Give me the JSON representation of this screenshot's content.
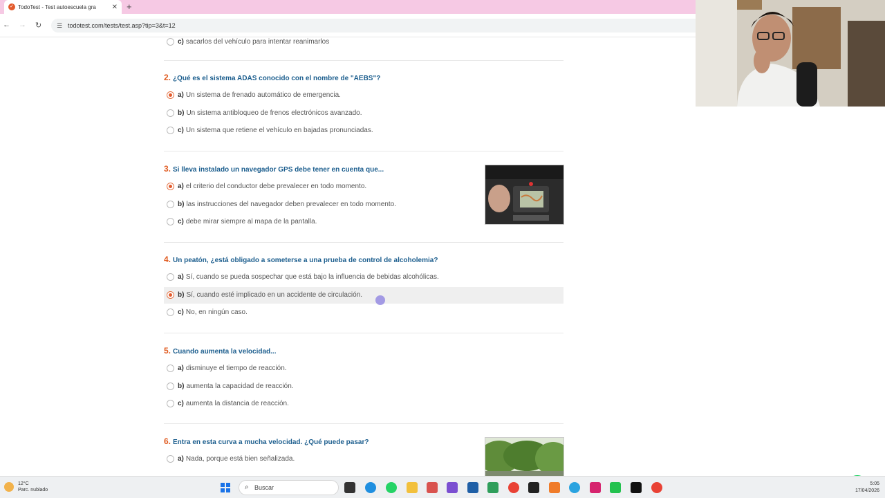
{
  "browser": {
    "tab_title": "TodoTest - Test autoescuela gra",
    "tab_favicon": "todotest-favicon",
    "new_tab_symbol": "+",
    "url": "todotest.com/tests/test.asp?tip=3&t=12"
  },
  "quiz": {
    "prev_option": {
      "letter": "c)",
      "text": "sacarlos del vehículo para intentar reanimarlos",
      "selected": false
    },
    "questions": [
      {
        "number": "2.",
        "title": "¿Qué es el sistema ADAS conocido con el nombre de \"AEBS\"?",
        "options": [
          {
            "letter": "a)",
            "text": "Un sistema de frenado automático de emergencia.",
            "selected": true
          },
          {
            "letter": "b)",
            "text": "Un sistema antibloqueo de frenos electrónicos avanzado.",
            "selected": false
          },
          {
            "letter": "c)",
            "text": "Un sistema que retiene el vehículo en bajadas pronunciadas.",
            "selected": false
          }
        ]
      },
      {
        "number": "3.",
        "title": "Si lleva instalado un navegador GPS debe tener en cuenta que...",
        "image": "car-gps-navigator-photo",
        "options": [
          {
            "letter": "a)",
            "text": "el criterio del conductor debe prevalecer en todo momento.",
            "selected": true
          },
          {
            "letter": "b)",
            "text": "las instrucciones del navegador deben prevalecer en todo momento.",
            "selected": false
          },
          {
            "letter": "c)",
            "text": "debe mirar siempre al mapa de la pantalla.",
            "selected": false
          }
        ]
      },
      {
        "number": "4.",
        "title": "Un peatón, ¿está obligado a someterse a una prueba de control de alcoholemia?",
        "options": [
          {
            "letter": "a)",
            "text": "Sí, cuando se pueda sospechar que está bajo la influencia de bebidas alcohólicas.",
            "selected": false
          },
          {
            "letter": "b)",
            "text": "Sí, cuando esté implicado en un accidente de circulación.",
            "selected": true,
            "highlighted": true
          },
          {
            "letter": "c)",
            "text": "No, en ningún caso.",
            "selected": false
          }
        ]
      },
      {
        "number": "5.",
        "title": "Cuando aumenta la velocidad...",
        "options": [
          {
            "letter": "a)",
            "text": "disminuye el tiempo de reacción.",
            "selected": false
          },
          {
            "letter": "b)",
            "text": "aumenta la capacidad de reacción.",
            "selected": false
          },
          {
            "letter": "c)",
            "text": "aumenta la distancia de reacción.",
            "selected": false
          }
        ]
      },
      {
        "number": "6.",
        "title": "Entra en esta curva a mucha velocidad. ¿Qué puede pasar?",
        "image": "road-curve-trees-photo",
        "options": [
          {
            "letter": "a)",
            "text": "Nada, porque está bien señalizada.",
            "selected": false
          }
        ]
      }
    ]
  },
  "whatsapp_icon": "whatsapp-icon",
  "webcam": "webcam-overlay",
  "taskbar": {
    "weather_temp": "12°C",
    "weather_desc": "Parc. nublado",
    "search_placeholder": "Buscar",
    "time": "5:05",
    "date": "17/04/2026",
    "icons": [
      "windows-start-icon",
      "task-view-icon",
      "edge-icon",
      "whatsapp-icon",
      "file-explorer-icon",
      "office-icon",
      "app-icon",
      "store-icon",
      "android-icon",
      "chrome-icon",
      "media-icon",
      "rtve-icon",
      "telegram-icon",
      "instagram-icon",
      "kick-icon",
      "tiktok-icon",
      "chrome-profile-icon"
    ]
  },
  "colors": {
    "tab_bar": "#f6c9e4",
    "question_title": "#1c5e8e",
    "question_number": "#e05b20",
    "selected_radio": "#e35b2d",
    "whatsapp": "#25d366"
  }
}
